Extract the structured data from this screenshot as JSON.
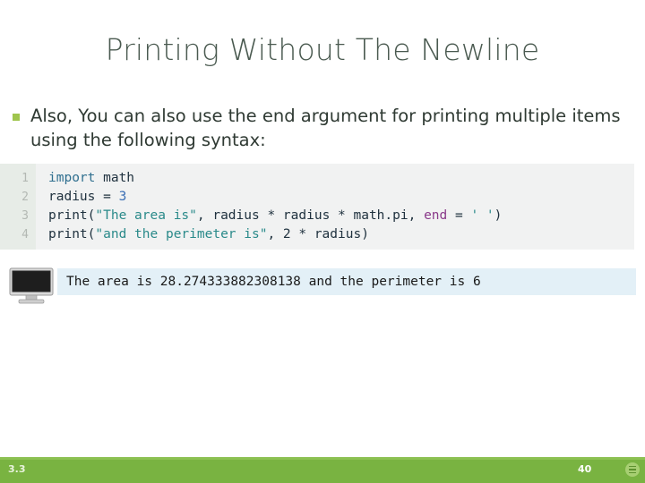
{
  "slide": {
    "title": "Printing Without The Newline",
    "accent_green": "#79b341",
    "bullet_marker_color": "#9fc54d",
    "title_color": "#4a5a50"
  },
  "body": {
    "bullets": [
      "Also, You can also use the end argument for printing multiple items using the following syntax:"
    ]
  },
  "code": {
    "background": "#f1f2f2",
    "gutter_background": "#e7ece7",
    "line_numbers": [
      "1",
      "2",
      "3",
      "4"
    ],
    "lines": [
      [
        {
          "t": "import",
          "c": "kw"
        },
        {
          "t": " math",
          "c": "plain"
        }
      ],
      [
        {
          "t": "radius = ",
          "c": "plain"
        },
        {
          "t": "3",
          "c": "num"
        }
      ],
      [
        {
          "t": "print(",
          "c": "plain"
        },
        {
          "t": "\"The area is\"",
          "c": "str"
        },
        {
          "t": ", radius * radius * math.pi, ",
          "c": "plain"
        },
        {
          "t": "end",
          "c": "named"
        },
        {
          "t": " = ",
          "c": "plain"
        },
        {
          "t": "' '",
          "c": "str"
        },
        {
          "t": ")",
          "c": "plain"
        }
      ],
      [
        {
          "t": "print(",
          "c": "plain"
        },
        {
          "t": "\"and the perimeter is\"",
          "c": "str"
        },
        {
          "t": ", 2 * radius)",
          "c": "plain"
        }
      ]
    ]
  },
  "output": {
    "icon": "monitor-icon",
    "background": "#e3f0f7",
    "text": "The area is 28.274333882308138 and the perimeter is 6"
  },
  "footer": {
    "left_label": "3.3",
    "page_number": "40",
    "badge_icon": "menu-badge-icon"
  }
}
